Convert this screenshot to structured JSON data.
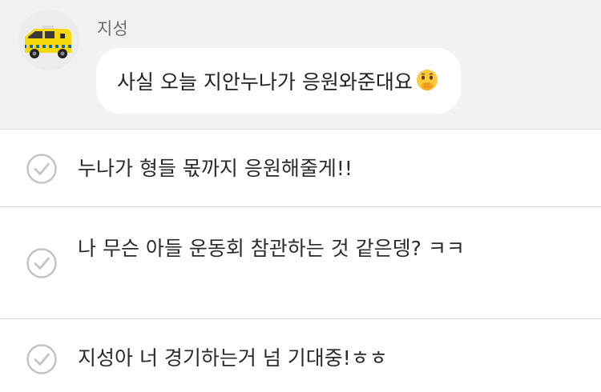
{
  "chat": {
    "sender_name": "지성",
    "message": "사실 오늘 지안누나가 응원와준대요",
    "message_emoji": "face-with-hand-over-mouth-emoji",
    "avatar_icon": "yellow-ambulance-avatar-icon"
  },
  "options": [
    {
      "text": "누나가 형들 몫까지 응원해줄게!!",
      "icon": "check-circle-icon"
    },
    {
      "text": "나 무슨 아들 운동회 참관하는 것 같은뎅? ㅋㅋ",
      "icon": "check-circle-icon"
    },
    {
      "text": "지성아 너 경기하는거 넘 기대중!ㅎㅎ",
      "icon": "check-circle-icon"
    }
  ],
  "colors": {
    "header_bg": "#f2f2f2",
    "bubble_bg": "#ffffff",
    "text": "#222222",
    "name": "#6f6f6f",
    "divider": "#d9d9d9",
    "check": "#c4c4c4",
    "avatar_vehicle": "#f5d90a"
  }
}
